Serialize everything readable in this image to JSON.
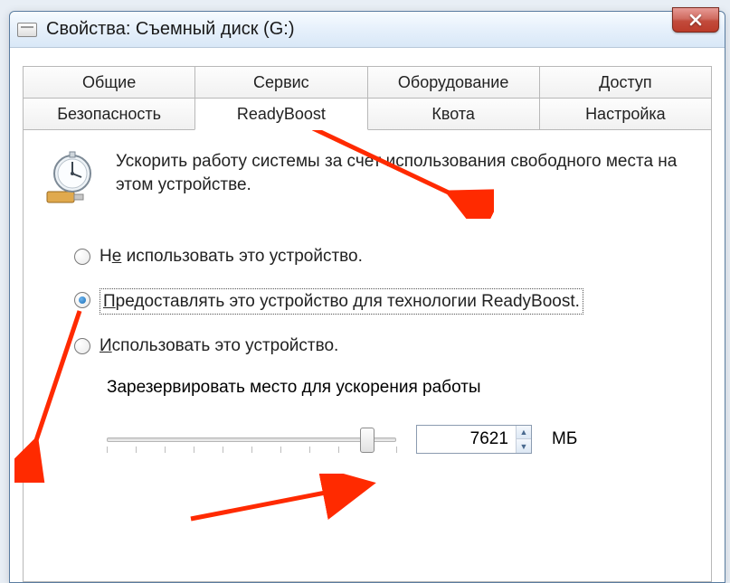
{
  "window": {
    "title": "Свойства: Съемный диск (G:)",
    "close_glyph": "X"
  },
  "tabs": {
    "row1": [
      "Общие",
      "Сервис",
      "Оборудование",
      "Доступ"
    ],
    "row2": [
      "Безопасность",
      "ReadyBoost",
      "Квота",
      "Настройка"
    ],
    "active": "ReadyBoost"
  },
  "panel": {
    "intro": "Ускорить работу системы за счет использования свободного места на этом устройстве.",
    "options": [
      {
        "label_pre": "Н",
        "label_u": "е",
        "label_post": " использовать это устройство.",
        "checked": false
      },
      {
        "label_pre": "",
        "label_u": "П",
        "label_post": "редоставлять это устройство для технологии ReadyBoost.",
        "checked": true,
        "focused": true
      },
      {
        "label_pre": "",
        "label_u": "И",
        "label_post": "спользовать это устройство.",
        "checked": false
      }
    ],
    "reserve_label_pre": "Зарезервировать ",
    "reserve_label_u": "м",
    "reserve_label_post": "есто для ускорения работы",
    "slider": {
      "min": 0,
      "max": 100,
      "value": 92
    },
    "reserve_value": "7621",
    "unit": "МБ"
  },
  "icons": {
    "drive": "drive-icon",
    "stopwatch": "stopwatch-icon",
    "close": "close-icon"
  }
}
